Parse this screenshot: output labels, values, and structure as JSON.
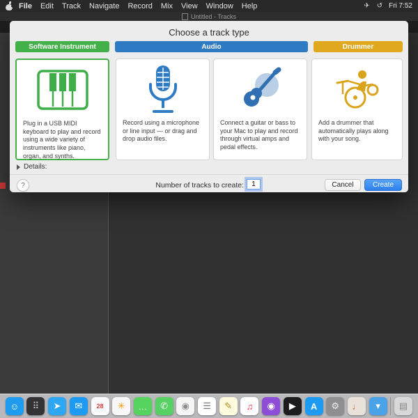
{
  "menu_bar": {
    "items": [
      "File",
      "Edit",
      "Track",
      "Navigate",
      "Record",
      "Mix",
      "View",
      "Window",
      "Help"
    ],
    "clock": "Fri 7:52"
  },
  "window": {
    "title": "Untitled - Tracks"
  },
  "dialog": {
    "title": "Choose a track type",
    "categories": [
      {
        "label": "Software Instrument",
        "color": "#43b049",
        "selected": true
      },
      {
        "label": "Audio",
        "color": "#2e7bc4",
        "selected": false
      },
      {
        "label": "Drummer",
        "color": "#dfa81e",
        "selected": false
      }
    ],
    "cards": [
      {
        "icon": "piano-icon",
        "selected": true,
        "description": "Plug in a USB MIDI keyboard to play and record using a wide variety of instruments like piano, organ, and synths."
      },
      {
        "icon": "microphone-icon",
        "selected": false,
        "description": "Record using a microphone or line input — or drag and drop audio files."
      },
      {
        "icon": "guitar-icon",
        "selected": false,
        "description": "Connect a guitar or bass to your Mac to play and record through virtual amps and pedal effects."
      },
      {
        "icon": "drummer-icon",
        "selected": false,
        "description": "Add a drummer that automatically plays along with your song."
      }
    ],
    "details_label": "Details:",
    "help_label": "?",
    "tracks_label": "Number of tracks to create:",
    "tracks_value": "1",
    "cancel_label": "Cancel",
    "create_label": "Create",
    "accent_green": "#43b049",
    "accent_blue": "#2e7bc4",
    "accent_yellow": "#dfa81e",
    "create_button_color": "#2d7ff0"
  },
  "dock": {
    "items": [
      {
        "name": "finder",
        "glyph": "☺",
        "bg": "#1f9bf0",
        "fg": "#ffffff"
      },
      {
        "name": "launchpad",
        "glyph": "⠿",
        "bg": "#333336",
        "fg": "#cccccc"
      },
      {
        "name": "safari",
        "glyph": "➤",
        "bg": "#2ea7f2",
        "fg": "#ffffff"
      },
      {
        "name": "mail",
        "glyph": "✉",
        "bg": "#1d9bf2",
        "fg": "#ffffff"
      },
      {
        "name": "calendar",
        "glyph": "28",
        "bg": "#fafafa",
        "fg": "#e23b3b"
      },
      {
        "name": "photos",
        "glyph": "✳",
        "bg": "#f7f7f7",
        "fg": "#ff9500"
      },
      {
        "name": "messages",
        "glyph": "…",
        "bg": "#56d35f",
        "fg": "#ffffff"
      },
      {
        "name": "facetime",
        "glyph": "✆",
        "bg": "#57d163",
        "fg": "#ffffff"
      },
      {
        "name": "contacts",
        "glyph": "◉",
        "bg": "#f5f5f5",
        "fg": "#8e8e93"
      },
      {
        "name": "reminders",
        "glyph": "☰",
        "bg": "#ffffff",
        "fg": "#777777"
      },
      {
        "name": "notes",
        "glyph": "✎",
        "bg": "#fff9dd",
        "fg": "#b08d2f"
      },
      {
        "name": "music",
        "glyph": "♫",
        "bg": "#ffffff",
        "fg": "#fa2d48"
      },
      {
        "name": "podcasts",
        "glyph": "◉",
        "bg": "#8e4dd6",
        "fg": "#ffffff"
      },
      {
        "name": "tv",
        "glyph": "▶",
        "bg": "#1c1c1e",
        "fg": "#ffffff"
      },
      {
        "name": "app-store",
        "glyph": "A",
        "bg": "#1d9bf2",
        "fg": "#ffffff"
      },
      {
        "name": "system-preferences",
        "glyph": "⚙",
        "bg": "#8e8e93",
        "fg": "#ededed"
      },
      {
        "name": "garageband",
        "glyph": "♩",
        "bg": "#e8e2da",
        "fg": "#c96a2a"
      },
      {
        "name": "downloads",
        "glyph": "▾",
        "bg": "#4aa3e8",
        "fg": "#ffffff"
      },
      {
        "divider": true
      },
      {
        "name": "trash",
        "glyph": "▤",
        "bg": "#d8d8d8",
        "fg": "#888888"
      }
    ]
  }
}
